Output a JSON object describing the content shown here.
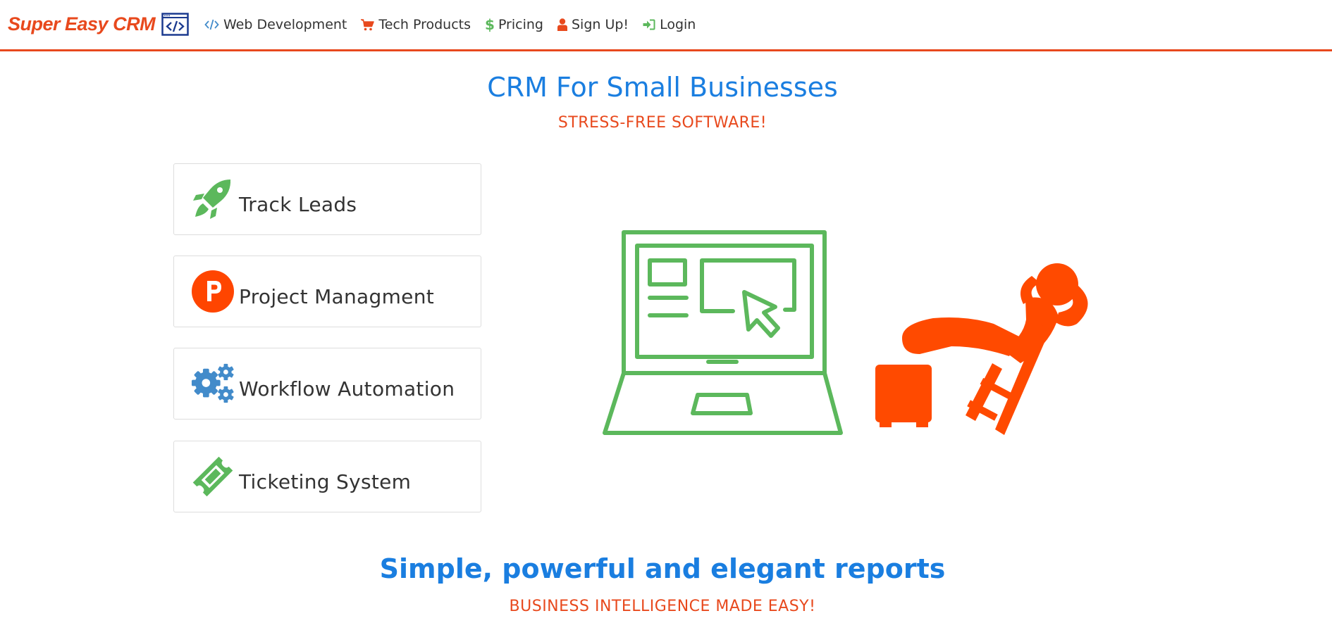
{
  "brand": {
    "name": "Super Easy CRM",
    "logo_icon": "code-window-icon"
  },
  "nav": {
    "items": [
      {
        "label": "Web Development",
        "icon": "code-icon"
      },
      {
        "label": "Tech Products",
        "icon": "shopping-cart-icon"
      },
      {
        "label": "Pricing",
        "icon": "dollar-icon"
      },
      {
        "label": "Sign Up!",
        "icon": "user-icon"
      },
      {
        "label": "Login",
        "icon": "sign-in-icon"
      }
    ]
  },
  "hero": {
    "title": "CRM For Small Businesses",
    "subtitle": "STRESS-FREE SOFTWARE!"
  },
  "features": [
    {
      "label": "Track Leads",
      "icon": "rocket-icon"
    },
    {
      "label": "Project Managment",
      "icon": "product-hunt-icon"
    },
    {
      "label": "Workflow Automation",
      "icon": "gears-icon"
    },
    {
      "label": "Ticketing System",
      "icon": "ticket-icon"
    }
  ],
  "illustration": {
    "icons": [
      "laptop-icon",
      "relaxing-person-icon"
    ]
  },
  "reports": {
    "title": "Simple, powerful and elegant reports",
    "subtitle": "BUSINESS INTELLIGENCE MADE EASY!"
  },
  "colors": {
    "accent_orange": "#e8491d",
    "heading_blue": "#1a7ee0",
    "icon_green": "#5cb85c",
    "icon_blue": "#428bca"
  }
}
